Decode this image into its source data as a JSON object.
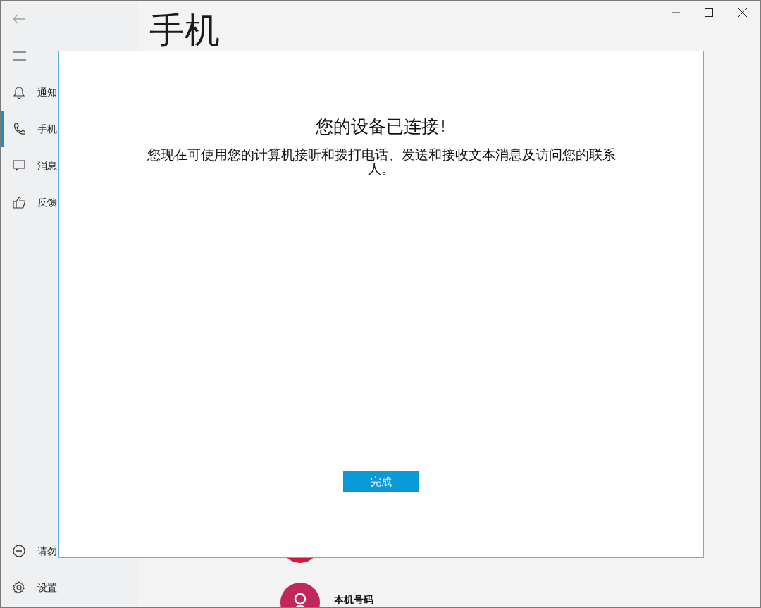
{
  "page_title": "手机",
  "sidebar": {
    "items": [
      {
        "label": "通知",
        "kind": "bell",
        "selected": false
      },
      {
        "label": "手机",
        "kind": "phone",
        "selected": true
      },
      {
        "label": "消息",
        "kind": "message",
        "selected": false
      },
      {
        "label": "反馈",
        "kind": "thumb",
        "selected": false
      }
    ],
    "bottom_items": [
      {
        "label": "请勿",
        "kind": "minus"
      },
      {
        "label": "设置",
        "kind": "gear"
      }
    ]
  },
  "content": {
    "rows": [
      {
        "label": "本机号码",
        "color": "#c0285a"
      }
    ]
  },
  "dialog": {
    "title": "您的设备已连接!",
    "message": "您现在可使用您的计算机接听和拨打电话、发送和接收文本消息及访问您的联系人。",
    "button": "完成"
  }
}
